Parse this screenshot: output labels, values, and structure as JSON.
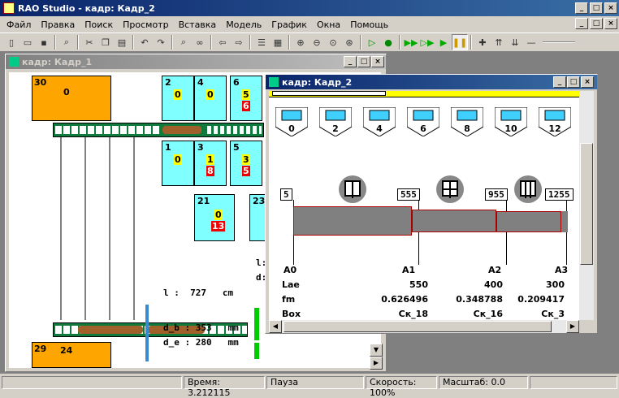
{
  "app": {
    "title": "RAO Studio - кадр: Кадр_2",
    "icon": "app-icon"
  },
  "menu": [
    "Файл",
    "Правка",
    "Поиск",
    "Просмотр",
    "Вставка",
    "Модель",
    "График",
    "Окна",
    "Помощь"
  ],
  "frame1": {
    "title": "кадр: Кадр_1",
    "big_top": {
      "id": "30",
      "val": "0"
    },
    "big_bottom": {
      "id": "29",
      "val": "24"
    },
    "cells": [
      {
        "id": "2",
        "a": "0",
        "b": ""
      },
      {
        "id": "4",
        "a": "0",
        "b": ""
      },
      {
        "id": "6",
        "a": "5",
        "b": "6"
      },
      {
        "id": "1",
        "a": "0",
        "b": ""
      },
      {
        "id": "3",
        "a": "1",
        "b": "8"
      },
      {
        "id": "5",
        "a": "3",
        "b": "5"
      },
      {
        "id": "21",
        "a": "0",
        "b": "13"
      },
      {
        "id": "23",
        "a": "",
        "b": ""
      }
    ],
    "l_label": "l :",
    "l_val": "727",
    "l_unit": "cm",
    "db_label": "d_b :",
    "db_val": "353",
    "db_unit": "mm",
    "de_label": "d_e :",
    "de_val": "280",
    "de_unit": "mm",
    "side_l": "l:",
    "side_d": "d:"
  },
  "frame2": {
    "title": "кадр: Кадр_2",
    "stations": [
      "0",
      "2",
      "4",
      "6",
      "8",
      "10",
      "12"
    ],
    "markers": [
      "5",
      "555",
      "955",
      "1255"
    ],
    "headers": [
      "A0",
      "A1",
      "A2",
      "A3"
    ],
    "rows": [
      {
        "label": "Lae",
        "v": [
          "550",
          "400",
          "300"
        ]
      },
      {
        "label": "fm",
        "v": [
          "0.626496",
          "0.348788",
          "0.209417"
        ]
      },
      {
        "label": "Box",
        "v": [
          "Ск_18",
          "Ск_16",
          "Ск_3"
        ]
      }
    ]
  },
  "status": {
    "time_label": "Время: 3.212115",
    "state": "Пауза",
    "speed": "Скорость: 100%",
    "scale": "Масштаб: 0.0"
  },
  "colors": {
    "orange": "#ffa500",
    "cyan": "#7fffff",
    "navy": "#0a246a",
    "brown": "#a0602a",
    "green": "#0f7a3b"
  }
}
